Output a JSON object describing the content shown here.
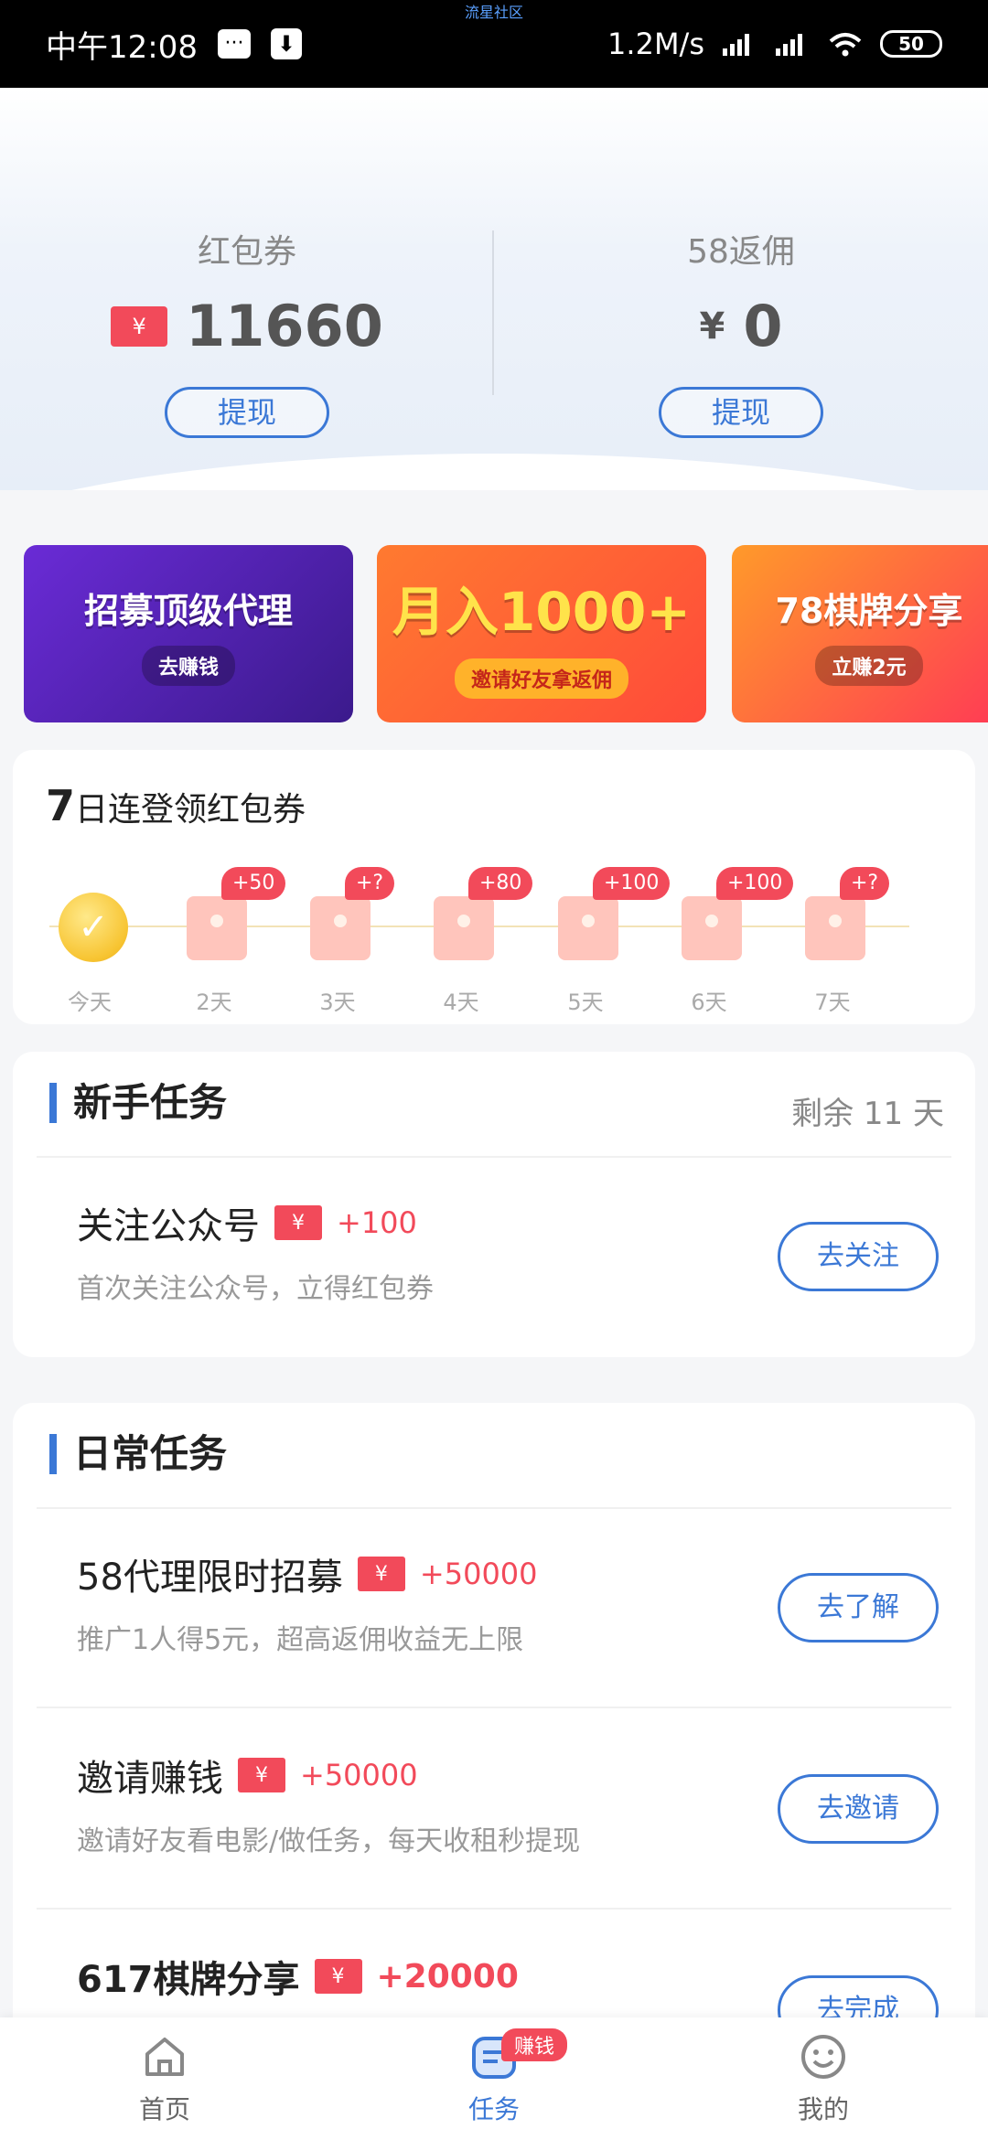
{
  "status_bar": {
    "time": "中午12:08",
    "net_speed": "1.2M/s",
    "battery": "50",
    "watermark": "流星社区"
  },
  "wallet": {
    "left": {
      "label": "红包券",
      "value": "11660",
      "coupon_icon_text": "¥",
      "button": "提现"
    },
    "right": {
      "label": "58返佣",
      "currency": "¥",
      "value": "0",
      "button": "提现"
    }
  },
  "banners": [
    {
      "main": "招募顶级代理",
      "sub": "去赚钱"
    },
    {
      "main": "月入1000+",
      "sub": "邀请好友拿返佣"
    },
    {
      "main": "78棋牌分享",
      "sub": "立赚2元"
    }
  ],
  "signin": {
    "title_big": "7",
    "title_rest": "日连登领红包券",
    "days": [
      {
        "label": "今天",
        "badge": "",
        "checked": true,
        "check_glyph": "✓"
      },
      {
        "label": "2天",
        "badge": "+50"
      },
      {
        "label": "3天",
        "badge": "+?"
      },
      {
        "label": "4天",
        "badge": "+80"
      },
      {
        "label": "5天",
        "badge": "+100"
      },
      {
        "label": "6天",
        "badge": "+100"
      },
      {
        "label": "7天",
        "badge": "+?"
      }
    ]
  },
  "newbie": {
    "title": "新手任务",
    "remaining": "剩余  11  天",
    "tasks": [
      {
        "title": "关注公众号",
        "coupon": "¥",
        "reward": "+100",
        "desc": "首次关注公众号，立得红包券",
        "button": "去关注"
      }
    ]
  },
  "daily": {
    "title": "日常任务",
    "tasks": [
      {
        "title": "58代理限时招募",
        "coupon": "¥",
        "reward": "+50000",
        "desc": "推广1人得5元，超高返佣收益无上限",
        "button": "去了解"
      },
      {
        "title": "邀请赚钱",
        "coupon": "¥",
        "reward": "+50000",
        "desc": "邀请好友看电影/做任务，每天收租秒提现",
        "button": "去邀请"
      },
      {
        "title": "617棋牌分享",
        "coupon": "¥",
        "reward": "+20000",
        "desc": "",
        "button": "去完成"
      }
    ]
  },
  "bottom_nav": {
    "items": [
      {
        "label": "首页",
        "icon": "home-icon"
      },
      {
        "label": "任务",
        "icon": "task-icon",
        "badge": "赚钱"
      },
      {
        "label": "我的",
        "icon": "smile-icon"
      }
    ]
  },
  "colors": {
    "accent": "#3b78d6",
    "red": "#f24a5a"
  }
}
